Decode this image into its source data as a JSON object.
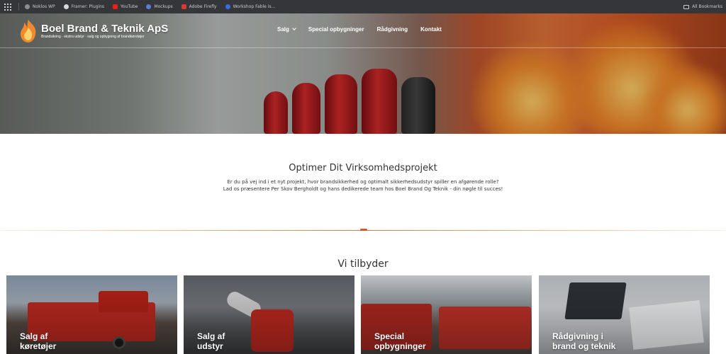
{
  "bookmarks": {
    "items": [
      {
        "label": "Noklos WP",
        "color": "#8a8d91"
      },
      {
        "label": "Framer: Plugins",
        "color": "#d7d8da"
      },
      {
        "label": "YouTube",
        "color": "#e62117"
      },
      {
        "label": "Mockups",
        "color": "#5d7bd8"
      },
      {
        "label": "Adobe Firefly",
        "color": "#d63a32"
      },
      {
        "label": "Workshop Fable is...",
        "color": "#3a6be0"
      }
    ],
    "all_label": "All Bookmarks"
  },
  "header": {
    "logo_title": "Boel Brand & Teknik ApS",
    "logo_subtitle": "Brandsikring · ekstra udstyr · salg og opbygning af brandkøretøjer",
    "nav": [
      {
        "label": "Salg",
        "dropdown": true
      },
      {
        "label": "Special opbygninger"
      },
      {
        "label": "Rådgivning"
      },
      {
        "label": "Kontakt"
      }
    ]
  },
  "intro": {
    "title": "Optimer Dit Virksomhedsprojekt",
    "line1": "Er du på vej ind i et nyt projekt, hvor brandsikkerhed og optimalt sikkerhedsudstyr spiller en afgørende rolle?",
    "line2": "Lad os præsentere Per Skov Bergholdt og hans dedikerede team hos Boel Brand Og Teknik - din nøgle til succes!"
  },
  "offer": {
    "title": "Vi tilbyder",
    "cards": [
      {
        "line1": "Salg af",
        "line2": "køretøjer"
      },
      {
        "line1": "Salg af",
        "line2": "udstyr"
      },
      {
        "line1": "Special",
        "line2": "opbygninger"
      },
      {
        "line1": "Rådgivning i",
        "line2": "brand og teknik"
      }
    ]
  },
  "colors": {
    "accent": "#e97832",
    "text": "#333333",
    "bookmark_bar": "#35363a"
  }
}
